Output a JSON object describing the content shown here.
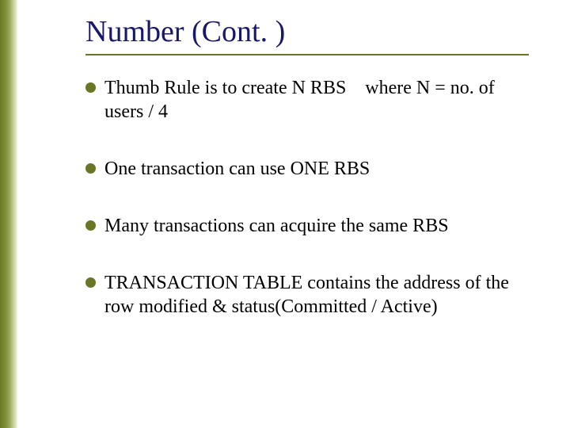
{
  "title": "Number (Cont. )",
  "bullets": [
    "Thumb Rule is to create N RBS    where N = no. of users / 4",
    "One transaction can use ONE RBS",
    "Many transactions can acquire the same RBS",
    "TRANSACTION TABLE contains the address of the row modified & status(Committed / Active)"
  ]
}
